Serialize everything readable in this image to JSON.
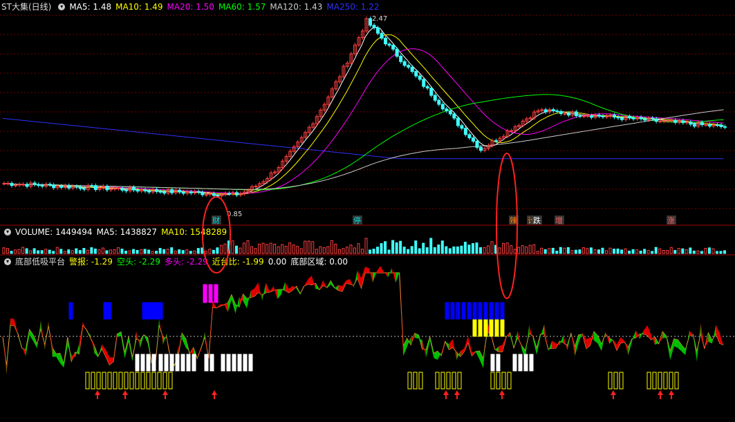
{
  "chart_data": [
    {
      "type": "candlestick",
      "title": "ST大集(日线)",
      "indicators": [
        {
          "name": "MA5",
          "value": "1.48",
          "color": "#ffffff"
        },
        {
          "name": "MA10",
          "value": "1.49",
          "color": "#ffff00"
        },
        {
          "name": "MA20",
          "value": "1.50",
          "color": "#ff00ff"
        },
        {
          "name": "MA60",
          "value": "1.57",
          "color": "#00ff00"
        },
        {
          "name": "MA120",
          "value": "1.43",
          "color": "#cccccc"
        },
        {
          "name": "MA250",
          "value": "1.22",
          "color": "#3030ff"
        }
      ],
      "annotations": {
        "high": "2.47",
        "low": "0.85"
      },
      "event_tags": [
        {
          "text": "财",
          "color": "#00dddd"
        },
        {
          "text": "停",
          "color": "#00dddd"
        },
        {
          "text": "辣",
          "color": "#ff8000"
        },
        {
          "text": "计",
          "color": "#ff8000"
        },
        {
          "text": "跌",
          "color": "#ffffff"
        },
        {
          "text": "增",
          "color": "#ff6060"
        },
        {
          "text": "涨",
          "color": "#ff6060"
        }
      ]
    },
    {
      "type": "bar",
      "title": "VOLUME",
      "indicators": [
        {
          "name": "VOLUME",
          "value": "1449494",
          "color": "#ffffff"
        },
        {
          "name": "MA5",
          "value": "1438827",
          "color": "#ffffff"
        },
        {
          "name": "MA10",
          "value": "1548289",
          "color": "#ffff00"
        }
      ]
    },
    {
      "type": "line",
      "title": "底部低吸平台",
      "indicators": [
        {
          "name": "警报",
          "value": "-1.29",
          "color": "#ffff00"
        },
        {
          "name": "空头",
          "value": "-2.29",
          "color": "#00ff00"
        },
        {
          "name": "多头",
          "value": "-2.29",
          "color": "#ff00ff"
        },
        {
          "name": "近台比",
          "value": "-1.99",
          "color": "#ffff00"
        },
        {
          "name": "",
          "value": "0.00",
          "color": "#ffffff"
        },
        {
          "name": "底部区域",
          "value": "0.00",
          "color": "#ffffff"
        }
      ]
    }
  ],
  "ui": {
    "dropdown_icon": "chevron-down-icon"
  }
}
